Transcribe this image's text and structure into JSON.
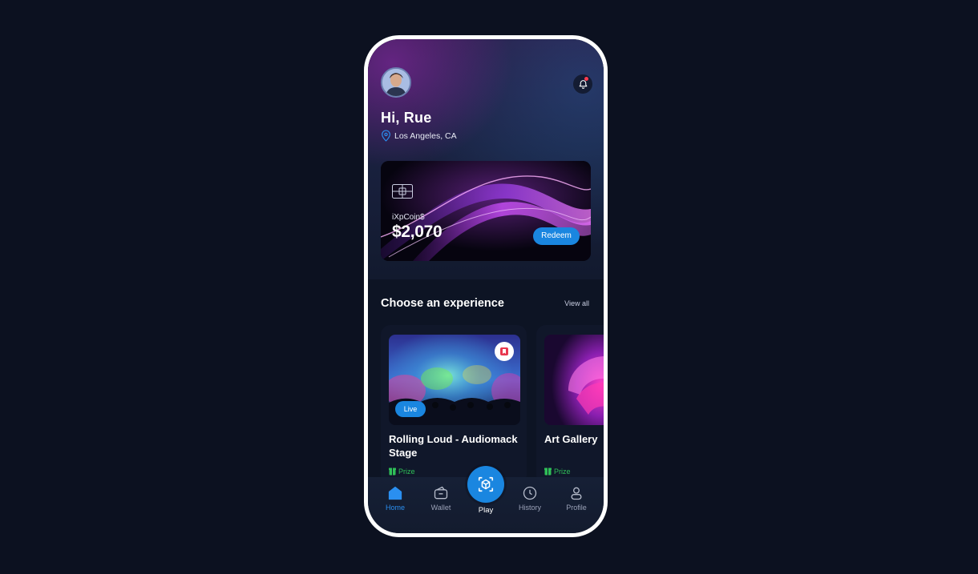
{
  "header": {
    "greeting": "Hi, Rue",
    "location": "Los Angeles, CA"
  },
  "card": {
    "currency_label": "iXpCoin$",
    "balance": "$2,070",
    "redeem_label": "Redeem"
  },
  "experiences": {
    "title": "Choose an experience",
    "view_all": "View all",
    "items": [
      {
        "title": "Rolling Loud - Audiomack Stage",
        "badge": "Live",
        "prize": "Prize"
      },
      {
        "title": "Art Gallery",
        "prize": "Prize"
      }
    ]
  },
  "tabbar": {
    "tabs": [
      {
        "label": "Home",
        "icon": "home-icon",
        "active": true
      },
      {
        "label": "Wallet",
        "icon": "wallet-icon"
      },
      {
        "label": "Play",
        "icon": "play-cube-icon"
      },
      {
        "label": "History",
        "icon": "clock-icon"
      },
      {
        "label": "Profile",
        "icon": "user-icon"
      }
    ]
  },
  "colors": {
    "background": "#0c1120",
    "accent": "#1a86e0",
    "prize": "#2fc058",
    "notification_dot": "#ff3b4f"
  }
}
